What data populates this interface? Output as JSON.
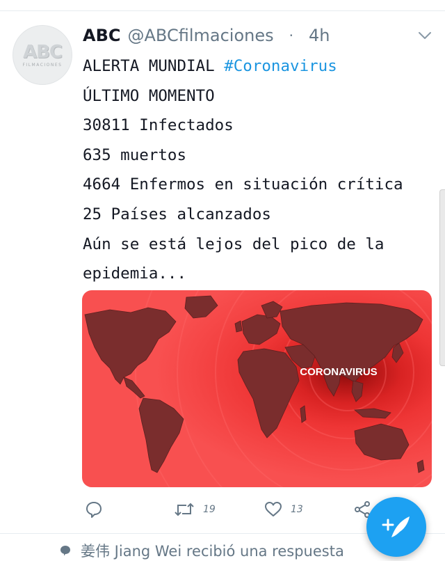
{
  "tweet": {
    "author_name": "ABC",
    "handle": "@ABCfilmaciones",
    "separator": "·",
    "time": "4h",
    "avatar": {
      "logo_text": "ABC",
      "logo_subtext": "FILMACIONES"
    },
    "lines": [
      {
        "parts": [
          {
            "text": "ALERTA MUNDIAL "
          },
          {
            "text": "#Coronavirus",
            "hashtag": true
          }
        ]
      },
      {
        "parts": [
          {
            "text": "ÚLTIMO MOMENTO"
          }
        ]
      },
      {
        "parts": [
          {
            "text": "30811 Infectados"
          }
        ]
      },
      {
        "parts": [
          {
            "text": "635 muertos"
          }
        ]
      },
      {
        "parts": [
          {
            "text": "4664 Enfermos en situación crítica"
          }
        ]
      },
      {
        "parts": [
          {
            "text": "25 Países alcanzados"
          }
        ]
      },
      {
        "parts": [
          {
            "text": "Aún se está lejos del pico de la"
          }
        ]
      },
      {
        "parts": [
          {
            "text": "epidemia..."
          }
        ]
      }
    ],
    "media": {
      "label": "CORONAVIRUS",
      "background_color": "#f03a3a",
      "map_color": "#7a2d2d"
    },
    "actions": {
      "reply": {
        "icon": "reply-icon",
        "count": ""
      },
      "retweet": {
        "icon": "retweet-icon",
        "count": "19"
      },
      "like": {
        "icon": "heart-icon",
        "count": "13"
      },
      "share": {
        "icon": "share-icon",
        "count": ""
      }
    }
  },
  "reply_note": {
    "icon": "speech-bubble-icon",
    "text": "姜伟 Jiang Wei recibió una respuesta"
  },
  "compose_button": {
    "icon": "compose-feather-icon"
  },
  "colors": {
    "accent": "#1da1f2",
    "hashtag": "#1b95e0",
    "muted": "#657786",
    "divider": "#e6ecf0"
  }
}
